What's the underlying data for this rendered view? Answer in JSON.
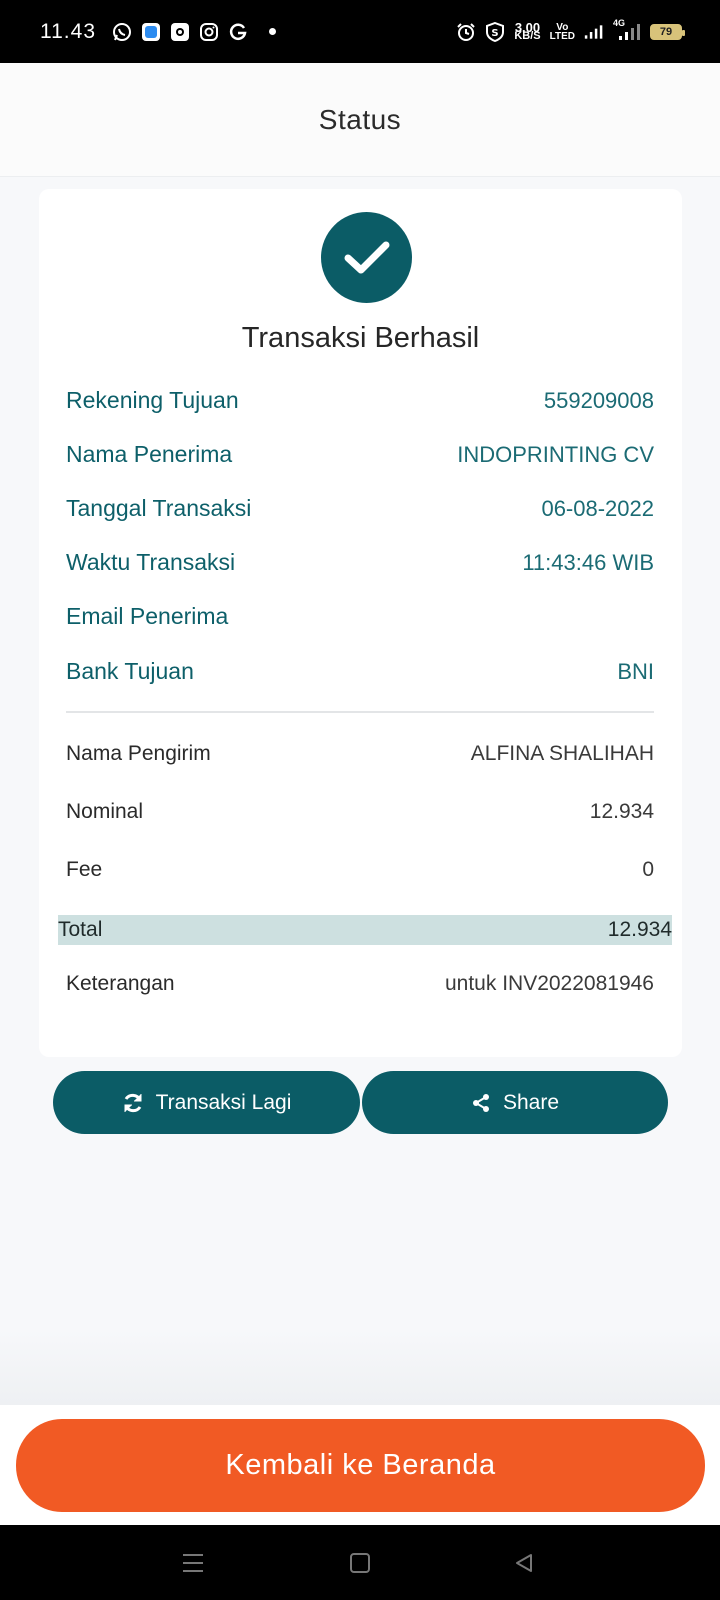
{
  "status_bar": {
    "time": "11.43",
    "net_speed_value": "3.00",
    "net_speed_unit": "KB/S",
    "volte_top": "Vo",
    "volte_bottom": "LTED",
    "network_type": "4G",
    "battery": "79",
    "icons": [
      "whatsapp-icon",
      "app-icon",
      "camera-app-icon",
      "instagram-icon",
      "google-icon",
      "alarm-icon",
      "shield-icon",
      "signal-icon"
    ]
  },
  "header": {
    "title": "Status"
  },
  "card": {
    "title": "Transaksi Berhasil",
    "recipient_rows": [
      {
        "label": "Rekening Tujuan",
        "value": "559209008"
      },
      {
        "label": "Nama Penerima",
        "value": "INDOPRINTING CV"
      },
      {
        "label": "Tanggal Transaksi",
        "value": "06-08-2022"
      },
      {
        "label": "Waktu Transaksi",
        "value": "11:43:46 WIB"
      },
      {
        "label": "Email Penerima",
        "value": ""
      },
      {
        "label": "Bank Tujuan",
        "value": "BNI"
      }
    ],
    "detail_rows": [
      {
        "label": "Nama Pengirim",
        "value": "ALFINA SHALIHAH"
      },
      {
        "label": "Nominal",
        "value": "12.934"
      },
      {
        "label": "Fee",
        "value": "0"
      }
    ],
    "total": {
      "label": "Total",
      "value": "12.934"
    },
    "note": {
      "label": "Keterangan",
      "value": "untuk INV2022081946"
    }
  },
  "actions": {
    "again_label": "Transaksi Lagi",
    "share_label": "Share"
  },
  "home_button": {
    "label": "Kembali ke Beranda"
  },
  "colors": {
    "primary": "#0b5c66",
    "accent": "#f15a24",
    "total_highlight": "#cde0e0"
  }
}
